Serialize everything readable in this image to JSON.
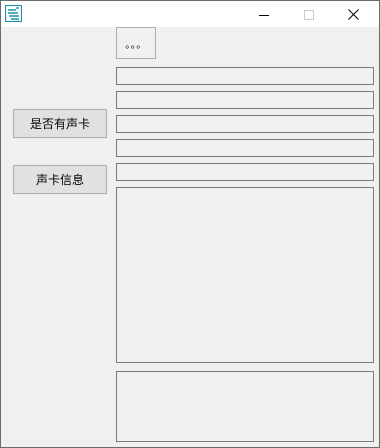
{
  "window": {
    "title": "",
    "icon": "app-logo-icon",
    "controls": [
      "minimize-icon",
      "maximize-icon",
      "close-icon"
    ]
  },
  "buttons": {
    "more_label": "。。。",
    "has_soundcard_label": "是否有声卡",
    "soundcard_info_label": "声卡信息"
  },
  "fields": {
    "field1": "",
    "field2": "",
    "field3": "",
    "field4": "",
    "field5": "",
    "output_main": "",
    "output_secondary": ""
  },
  "colors": {
    "icon_accent": "#1f8fa8",
    "window_bg": "#f0f0f0",
    "titlebar_bg": "#ffffff"
  }
}
